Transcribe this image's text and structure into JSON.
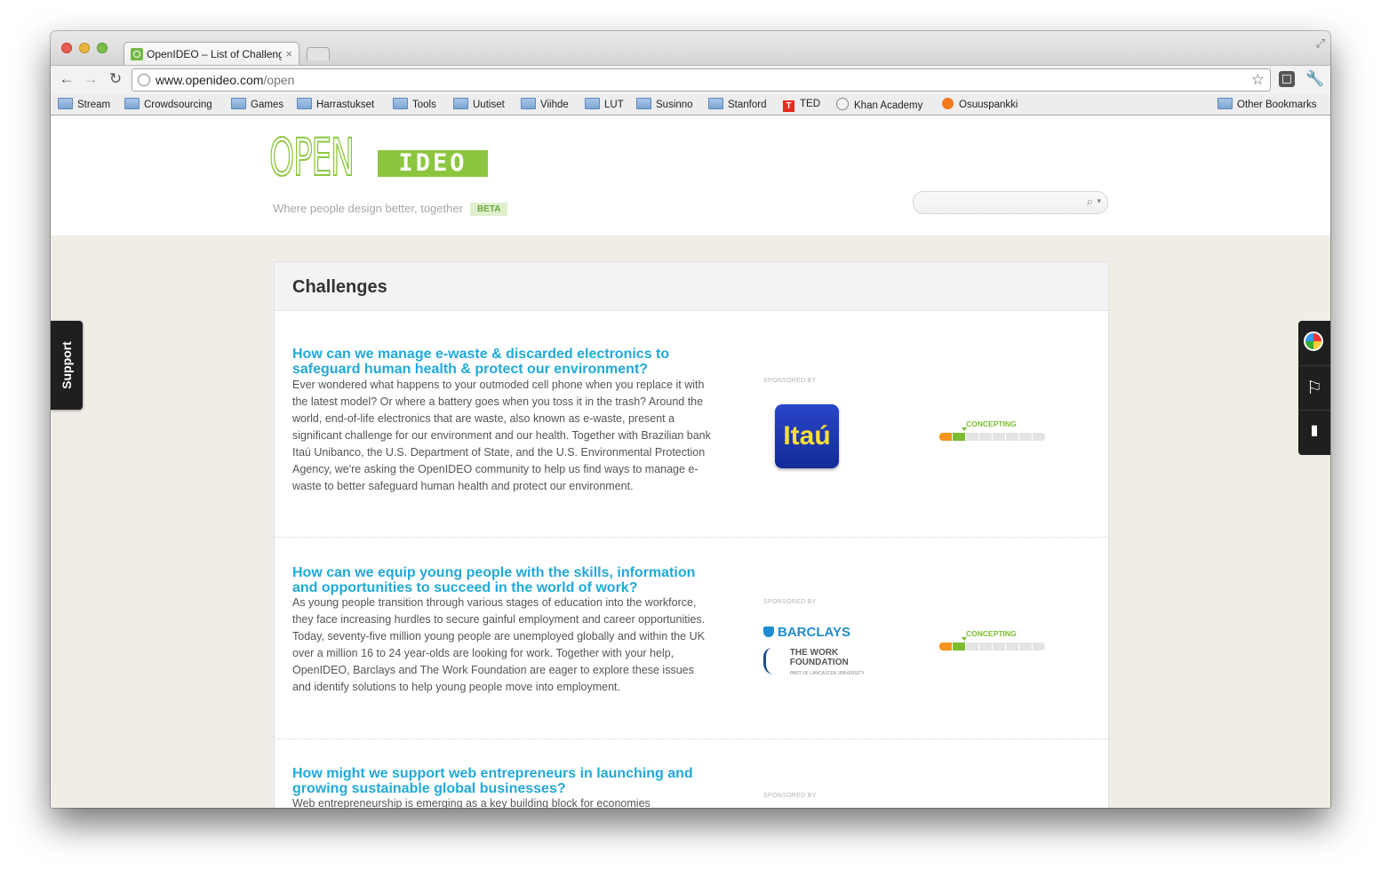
{
  "browser": {
    "tab_title": "OpenIDEO – List of Challenges",
    "tab_close": "×",
    "url_host": "www.openideo.com",
    "url_path": "/open",
    "star": "☆",
    "fullscreen": "⤢",
    "nav": {
      "back": "←",
      "forward": "→",
      "reload": "↻",
      "wrench": "🔧"
    },
    "bookmarks": [
      {
        "label": "Stream",
        "icon": "folder-icon"
      },
      {
        "label": "Crowdsourcing",
        "icon": "folder-icon"
      },
      {
        "label": "Games",
        "icon": "folder-icon"
      },
      {
        "label": "Harrastukset",
        "icon": "folder-icon"
      },
      {
        "label": "Tools",
        "icon": "folder-icon"
      },
      {
        "label": "Uutiset",
        "icon": "folder-icon"
      },
      {
        "label": "Viihde",
        "icon": "folder-icon"
      },
      {
        "label": "LUT",
        "icon": "folder-icon"
      },
      {
        "label": "Susinno",
        "icon": "folder-icon"
      },
      {
        "label": "Stanford",
        "icon": "folder-icon"
      },
      {
        "label": "TED",
        "icon": "ted-icon"
      },
      {
        "label": "Khan Academy",
        "icon": "globe-icon"
      },
      {
        "label": "Osuuspankki",
        "icon": "osuuspankki-icon"
      }
    ],
    "other_bookmarks": "Other Bookmarks"
  },
  "site": {
    "logo_open": "OPEN",
    "logo_ideo": "IDEO",
    "tagline": "Where people design better, together",
    "beta": "BETA",
    "search_placeholder": "",
    "support": "Support",
    "side_toolbar": {
      "flag": "⚐",
      "bookmark": "🔖"
    }
  },
  "challenges_section": {
    "heading": "Challenges",
    "items": [
      {
        "title": "How can we manage e-waste & discarded electronics to safeguard human health & protect our environment?",
        "description": "Ever wondered what happens to your outmoded cell phone when you replace it with the latest model? Or where a battery goes when you toss it in the trash? Around the world, end-of-life electronics that are waste, also known as e-waste, present a significant challenge for our environment and our health. Together with Brazilian bank Itaú Unibanco, the U.S. Department of State, and the U.S. Environmental Protection Agency, we're asking the OpenIDEO community to help us find ways to manage e-waste to better safeguard human health and protect our environment.",
        "sponsored_label": "SPONSORED BY",
        "sponsor_logo_text": "Itaú",
        "phase": "CONCEPTING",
        "phase_segments_total": 8,
        "phase_segments_filled": 2
      },
      {
        "title": "How can we equip young people with the skills, information and opportunities to succeed in the world of work?",
        "description": "As young people transition through various stages of education into the workforce, they face increasing hurdles to secure gainful employment and career opportunities. Today, seventy-five million young people are unemployed globally and within the UK over a million 16 to 24 year-olds are looking for work. Together with your help, OpenIDEO, Barclays and The Work Foundation are eager to explore these issues and identify solutions to help young people move into employment.",
        "sponsored_label": "SPONSORED BY",
        "sponsor_logo_text": "BARCLAYS",
        "sponsor2_line1": "THE WORK",
        "sponsor2_line2": "FOUNDATION",
        "sponsor2_sub": "PART OF LANCASTER UNIVERSITY",
        "phase": "CONCEPTING",
        "phase_segments_total": 8,
        "phase_segments_filled": 2
      },
      {
        "title": "How might we support web entrepreneurs in launching and growing sustainable global businesses?",
        "description": "Web entrepreneurship is emerging as a key building block for economies",
        "sponsored_label": "SPONSORED BY"
      }
    ]
  },
  "colors": {
    "accent_green": "#8cc63f",
    "link_blue": "#21a9d8",
    "phase_orange": "#f7941d",
    "phase_green": "#7cbd2f"
  }
}
